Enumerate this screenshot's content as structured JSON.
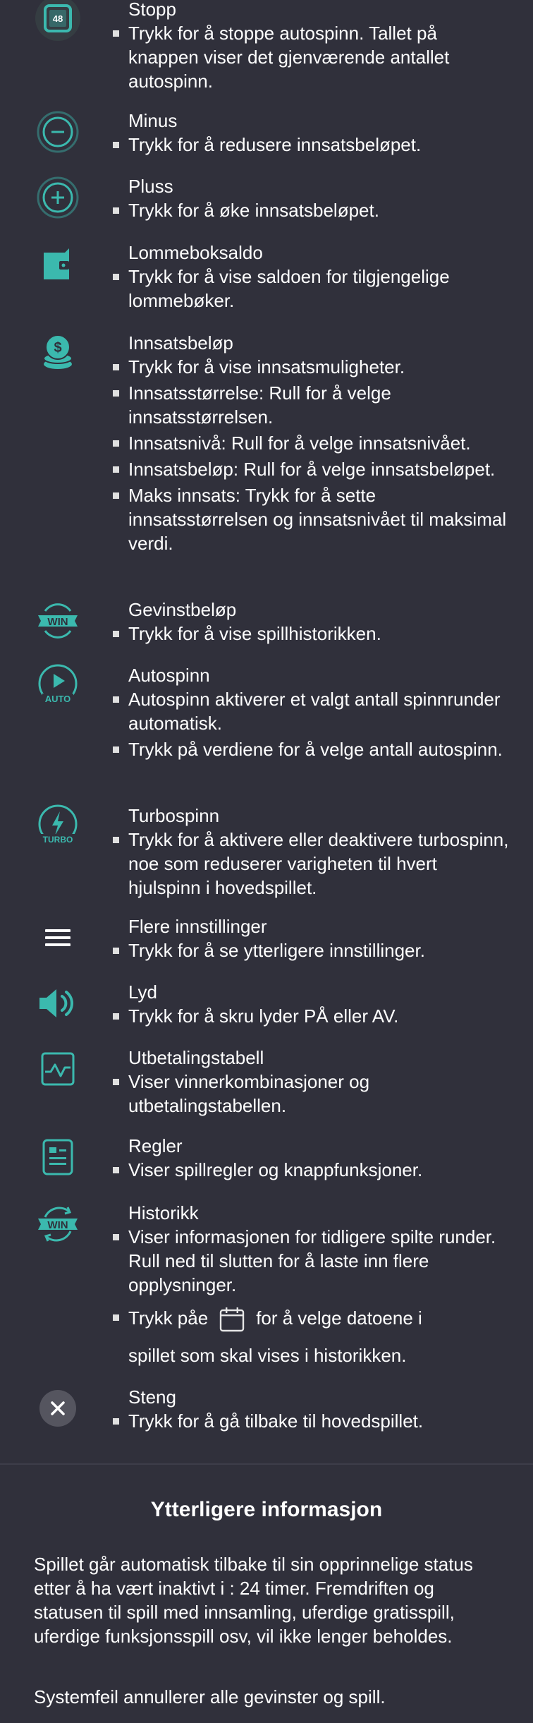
{
  "accent_color": "#3bb9ae",
  "items": [
    {
      "title": "Stopp",
      "icon": "stop-icon",
      "bullets": [
        "Trykk for å stoppe autospinn. Tallet på knappen viser det gjenværende antallet autospinn."
      ],
      "stop_count": "48"
    },
    {
      "title": "Minus",
      "icon": "minus-icon",
      "bullets": [
        "Trykk for å redusere innsatsbeløpet."
      ]
    },
    {
      "title": "Pluss",
      "icon": "plus-icon",
      "bullets": [
        "Trykk for å øke innsatsbeløpet."
      ]
    },
    {
      "title": "Lommeboksaldo",
      "icon": "wallet-icon",
      "bullets": [
        "Trykk for å vise saldoen for tilgjengelige lommebøker."
      ]
    },
    {
      "title": "Innsatsbeløp",
      "icon": "coins-icon",
      "bullets": [
        "Trykk for å vise innsatsmuligheter.",
        "Innsatsstørrelse: Rull for å velge innsatsstørrelsen.",
        "Innsatsnivå: Rull for å velge innsatsnivået.",
        "Innsatsbeløp: Rull for å velge innsatsbeløpet.",
        "Maks innsats: Trykk for å sette innsatsstørrelsen og innsatsnivået til maksimal verdi."
      ]
    },
    {
      "title": "Gevinstbeløp",
      "icon": "win-icon",
      "bullets": [
        "Trykk for å vise spillhistorikken."
      ],
      "win_label": "WIN"
    },
    {
      "title": "Autospinn",
      "icon": "autospin-icon",
      "bullets": [
        "Autospinn aktiverer et valgt antall spinnrunder automatisk.",
        "Trykk på verdiene for å velge antall autospinn."
      ],
      "auto_label": "AUTO"
    },
    {
      "title": "Turbospinn",
      "icon": "turbo-icon",
      "bullets": [
        "Trykk for å aktivere eller deaktivere turbospinn, noe som reduserer varigheten til hvert hjulspinn i hovedspillet."
      ],
      "turbo_label": "TURBO"
    },
    {
      "title": "Flere innstillinger",
      "icon": "menu-icon",
      "bullets": [
        "Trykk for å se ytterligere innstillinger."
      ]
    },
    {
      "title": "Lyd",
      "icon": "sound-icon",
      "bullets": [
        "Trykk for å skru lyder PÅ eller AV."
      ]
    },
    {
      "title": "Utbetalingstabell",
      "icon": "paytable-icon",
      "bullets": [
        "Viser vinnerkombinasjoner og utbetalingstabellen."
      ]
    },
    {
      "title": "Regler",
      "icon": "rules-icon",
      "bullets": [
        "Viser spillregler og knappfunksjoner."
      ]
    },
    {
      "title": "Historikk",
      "icon": "history-icon",
      "bullets": [
        "Viser informasjonen for tidligere spilte runder. Rull ned til slutten for å laste inn flere opplysninger."
      ],
      "calendar_before": "Trykk påe",
      "calendar_after": "for å velge datoene i",
      "calendar_line2": "spillet som skal vises i historikken.",
      "win_label": "WIN"
    },
    {
      "title": "Steng",
      "icon": "close-icon",
      "bullets": [
        "Trykk for å gå tilbake til hovedspillet."
      ]
    }
  ],
  "more_info": {
    "title": "Ytterligere informasjon",
    "paragraph1": "Spillet går automatisk tilbake til sin opprinnelige status etter å ha vært inaktivt i : 24 timer. Fremdriften og statusen til spill med innsamling, uferdige gratisspill, uferdige funksjonsspill osv, vil ikke lenger beholdes.",
    "paragraph2": "Systemfeil annullerer alle gevinster og spill."
  }
}
